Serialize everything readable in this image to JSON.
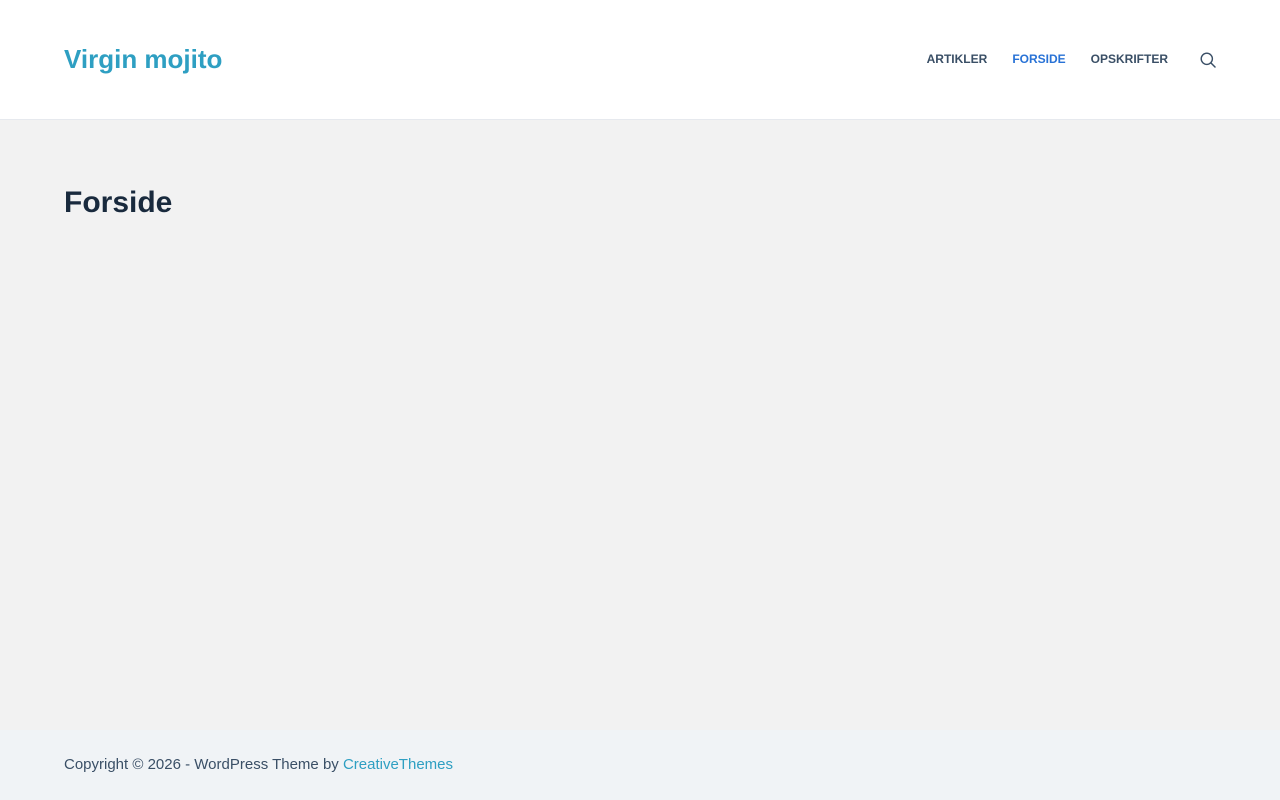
{
  "header": {
    "site_title": "Virgin mojito",
    "nav": [
      {
        "label": "ARTIKLER",
        "active": false
      },
      {
        "label": "FORSIDE",
        "active": true
      },
      {
        "label": "OPSKRIFTER",
        "active": false
      }
    ],
    "search_icon": "search-icon"
  },
  "main": {
    "page_title": "Forside"
  },
  "footer": {
    "copyright_text": "Copyright © 2026 - WordPress Theme by ",
    "credit_link": "CreativeThemes"
  },
  "colors": {
    "brand": "#2e9fc2",
    "nav_active": "#2872d6",
    "text_dark": "#192a3d",
    "text": "#3a4f66",
    "background": "#f2f2f2",
    "footer_background": "#f0f3f6"
  }
}
